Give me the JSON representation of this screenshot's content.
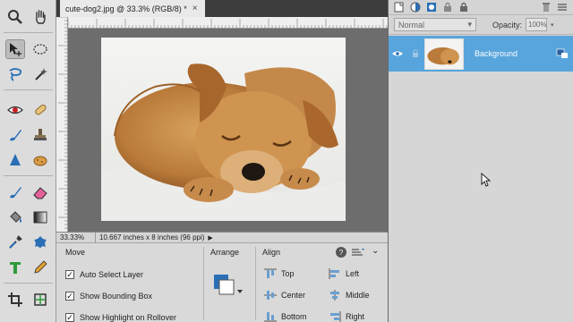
{
  "document": {
    "tab_title": "cute-dog2.jpg @ 33.3% (RGB/8) *",
    "close_glyph": "×"
  },
  "status_bar": {
    "zoom": "33.33%",
    "info": "10.667 inches x 8 inches (96 ppi)"
  },
  "tool_options": {
    "move_title": "Move",
    "auto_select": "Auto Select Layer",
    "show_bounding_box": "Show Bounding Box",
    "show_highlight": "Show Highlight on Rollover",
    "arrange_title": "Arrange",
    "align_title": "Align",
    "align": {
      "top": "Top",
      "center": "Center",
      "bottom": "Bottom",
      "left": "Left",
      "middle": "Middle",
      "right": "Right"
    },
    "help_glyph": "?"
  },
  "layers_panel": {
    "blend_mode": "Normal",
    "opacity_label": "Opacity:",
    "opacity_value": "100%",
    "layer_name": "Background"
  },
  "icons": [
    "zoom-icon",
    "hand-icon",
    "move-icon",
    "marquee-icon",
    "lasso-icon",
    "magic-wand-icon",
    "red-eye-icon",
    "spot-healing-icon",
    "brush-icon",
    "clone-stamp-icon",
    "blur-icon",
    "sponge-icon",
    "brush-icon",
    "eraser-icon",
    "paint-bucket-icon",
    "gradient-icon",
    "eyedropper-icon",
    "custom-shape-icon",
    "type-icon",
    "pencil-icon",
    "crop-icon",
    "recompose-icon"
  ],
  "colors": {
    "layer_selected": "#58a5dd",
    "canvas_bg": "#6d6d6d",
    "panel_bg": "#d4d4d4"
  }
}
